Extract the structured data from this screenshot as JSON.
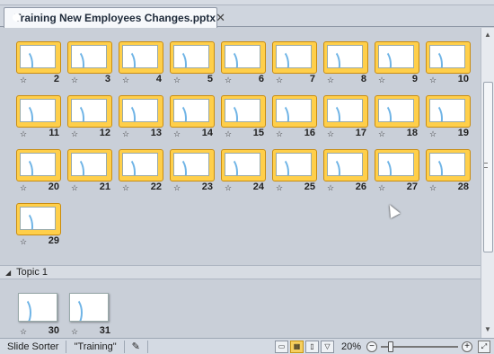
{
  "tab": {
    "title": "Training New Employees Changes.pptx",
    "close": "✕"
  },
  "slides_main": [
    "2",
    "3",
    "4",
    "5",
    "6",
    "7",
    "8",
    "9",
    "10",
    "11",
    "12",
    "13",
    "14",
    "15",
    "16",
    "17",
    "18",
    "19",
    "20",
    "21",
    "22",
    "23",
    "24",
    "25",
    "26",
    "27",
    "28",
    "29"
  ],
  "section": {
    "label": "Topic 1",
    "toggle": "◢"
  },
  "slides_topic": [
    "30",
    "31"
  ],
  "star_glyph": "☆",
  "status": {
    "view": "Slide Sorter",
    "theme": "\"Training\"",
    "zoom": "20%",
    "zoom_out": "−",
    "zoom_in": "+"
  },
  "colors": {
    "selection_fill": "#ffcf4a",
    "selection_border": "#c98d11",
    "background": "#c9cfd8"
  }
}
